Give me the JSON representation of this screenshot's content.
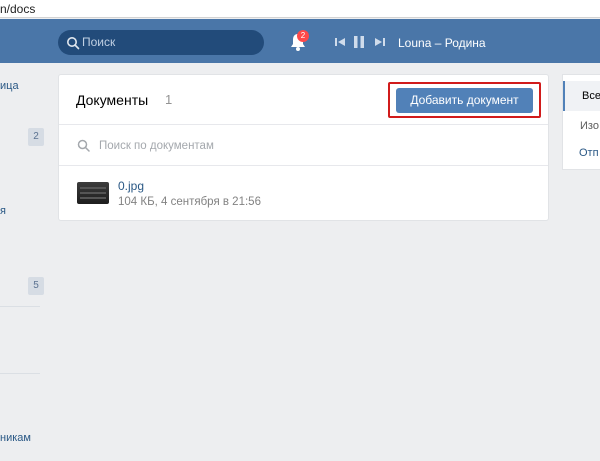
{
  "browser": {
    "url_fragment": "n/docs"
  },
  "header": {
    "search_placeholder": "Поиск",
    "notifications_count": "2",
    "player_track": "Louna – Родина"
  },
  "leftnav": {
    "item1_fragment": "ица",
    "count1": "2",
    "item2_fragment": "я",
    "count2": "5",
    "item3_fragment": "никам"
  },
  "documents": {
    "title": "Документы",
    "count": "1",
    "add_button": "Добавить документ",
    "search_placeholder": "Поиск по документам",
    "items": [
      {
        "name": "0.jpg",
        "meta": "104 КБ, 4 сентября в 21:56"
      }
    ]
  },
  "right_menu": {
    "item_all": "Все",
    "item_2": "Изо",
    "item_3": "Отп"
  },
  "colors": {
    "header": "#4a76a8",
    "button": "#5181b8",
    "highlight": "#d11b1b",
    "link": "#2a5885"
  }
}
